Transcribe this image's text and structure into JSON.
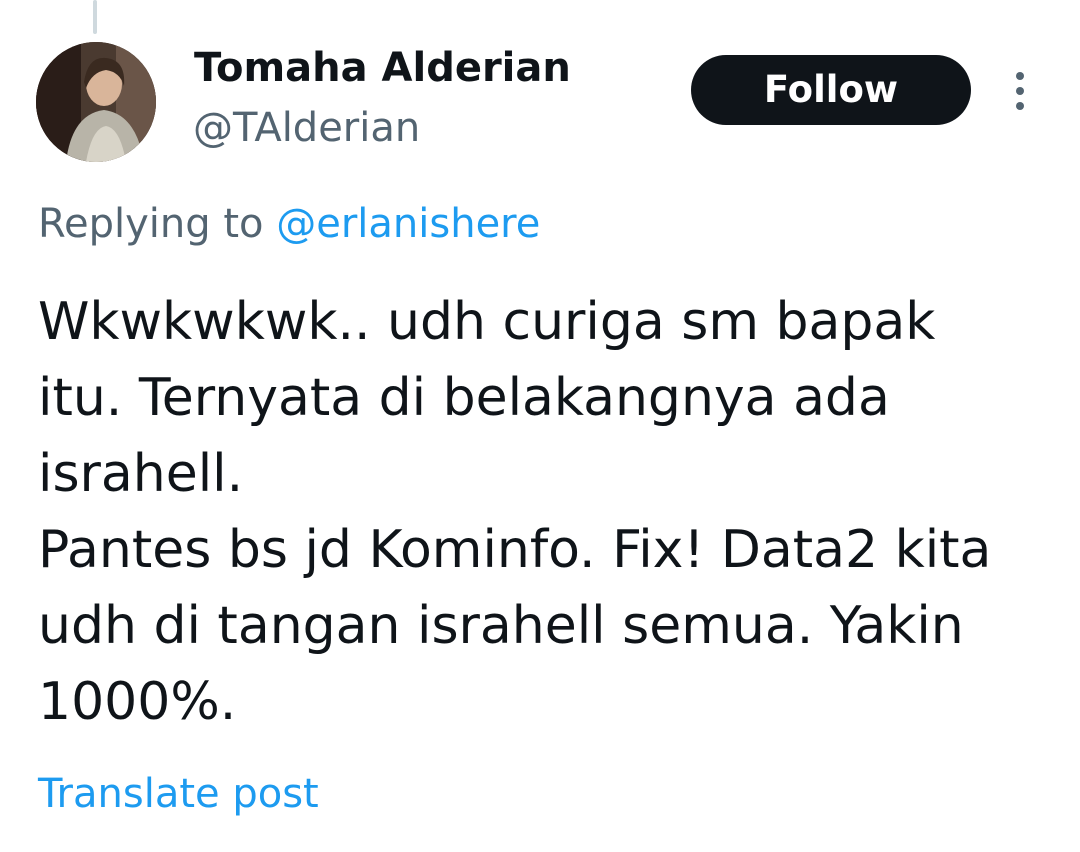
{
  "author": {
    "display_name": "Tomaha Alderian",
    "handle": "@TAlderian"
  },
  "follow_button": {
    "label": "Follow"
  },
  "more_menu": {
    "icon": "more-vertical-icon"
  },
  "reply_context": {
    "prefix": "Replying to ",
    "mention": "@erlanishere"
  },
  "post": {
    "lines": [
      "Wkwkwkwk.. udh curiga sm bapak",
      "itu. Ternyata di belakangnya ada",
      "israhell.",
      "Pantes bs jd Kominfo. Fix! Data2 kita",
      "udh di tangan israhell semua. Yakin",
      "1000%."
    ]
  },
  "translate": {
    "label": "Translate post"
  },
  "colors": {
    "text_primary": "#0f1419",
    "text_secondary": "#536471",
    "link": "#1d9bf0",
    "follow_bg": "#0f1419",
    "thread_line": "#cfd9de"
  }
}
